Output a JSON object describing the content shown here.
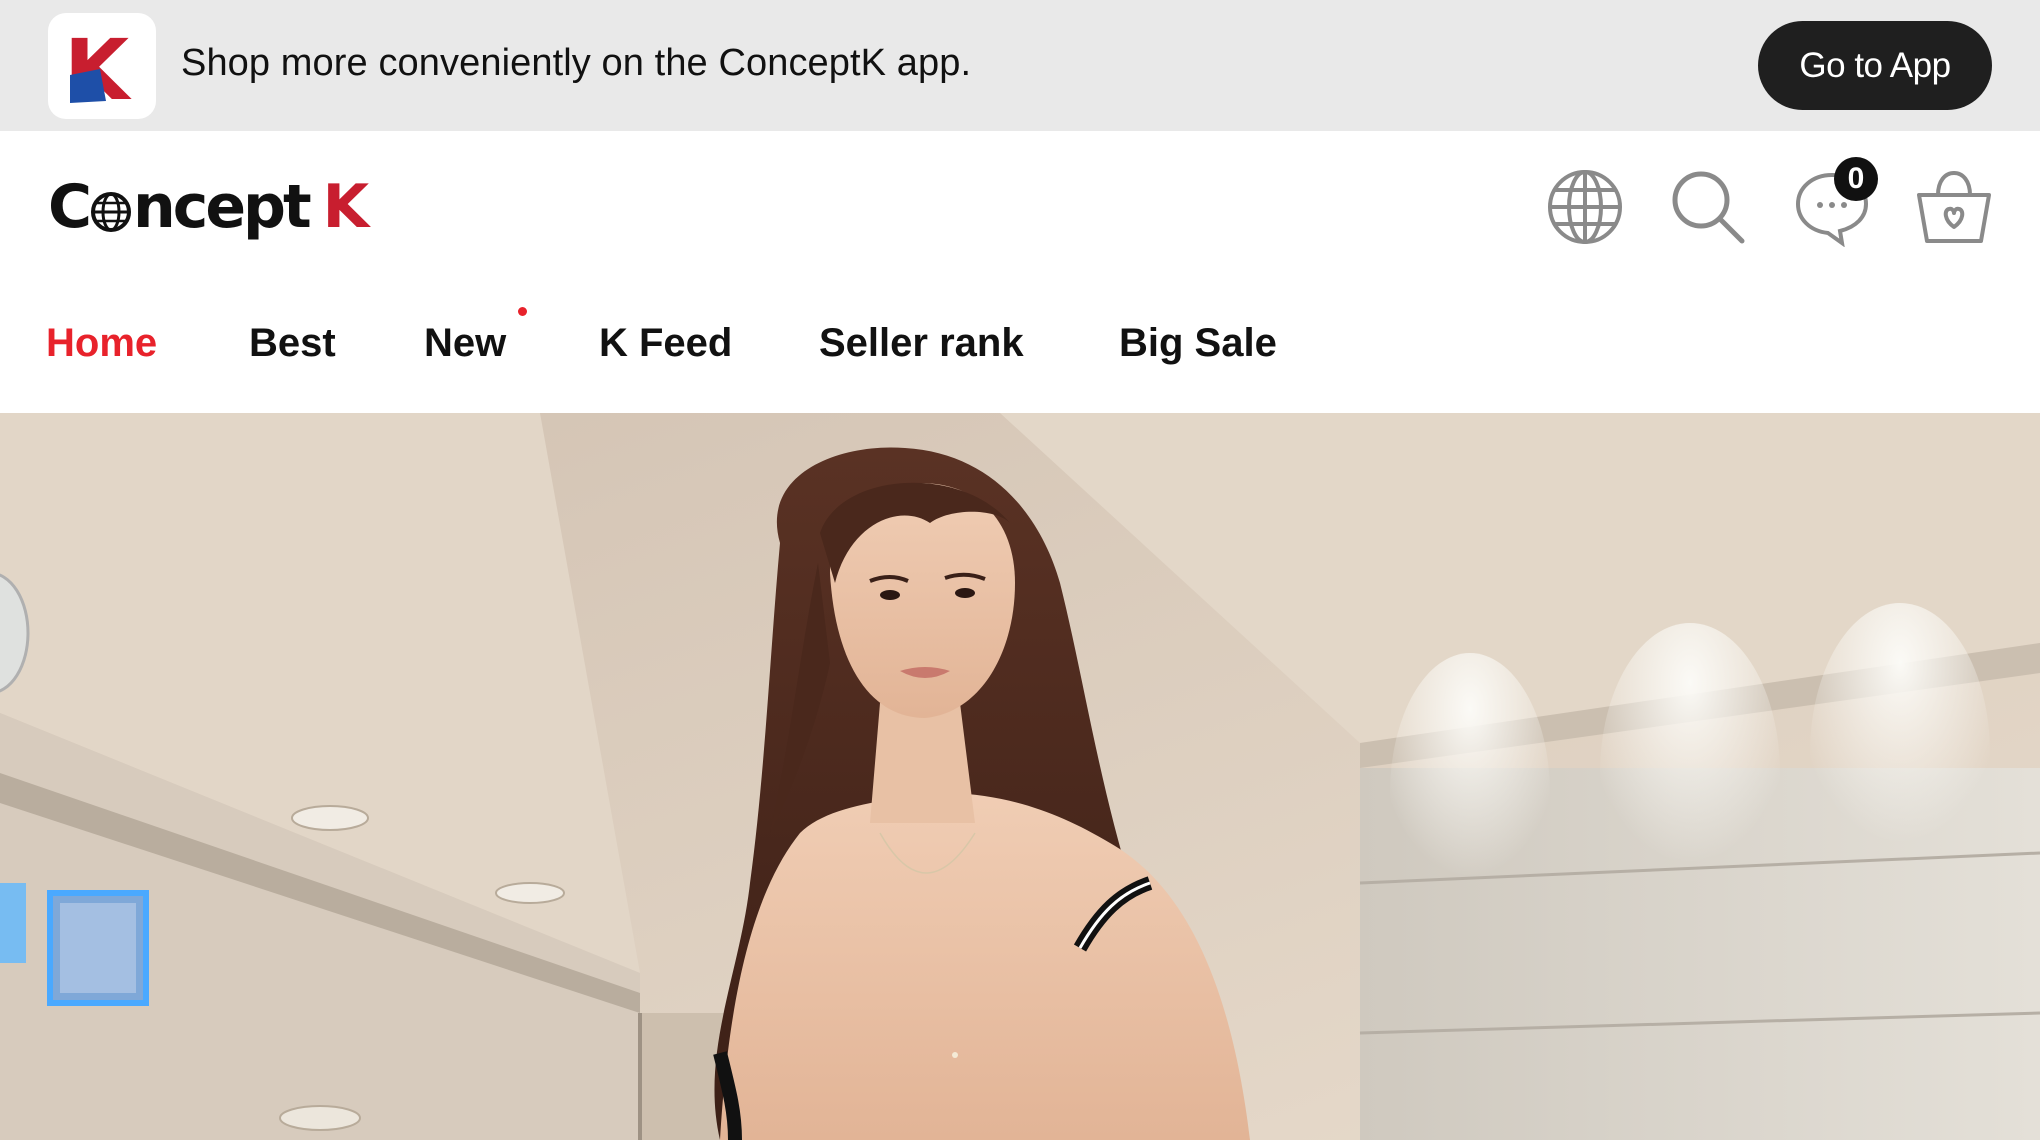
{
  "app_banner": {
    "logo_letter": "K",
    "message": "Shop more conveniently on the ConceptK app.",
    "button_label": "Go to App"
  },
  "header": {
    "brand_prefix": "C",
    "brand_suffix": "ncept",
    "brand_k": "K",
    "icons": [
      "globe-icon",
      "search-icon",
      "chat-icon",
      "cart-icon"
    ],
    "chat_badge_count": "0"
  },
  "nav": {
    "items": [
      {
        "label": "Home",
        "active": true
      },
      {
        "label": "Best",
        "active": false
      },
      {
        "label": "New",
        "active": false,
        "has_dot": true
      },
      {
        "label": "K Feed",
        "active": false
      },
      {
        "label": "Seller rank",
        "active": false
      },
      {
        "label": "Big Sale",
        "active": false
      }
    ]
  },
  "colors": {
    "accent_red": "#e8222b",
    "brand_blue": "#1e4fa8",
    "banner_bg": "#e9e9e9",
    "button_dark": "#1f1f1f"
  }
}
